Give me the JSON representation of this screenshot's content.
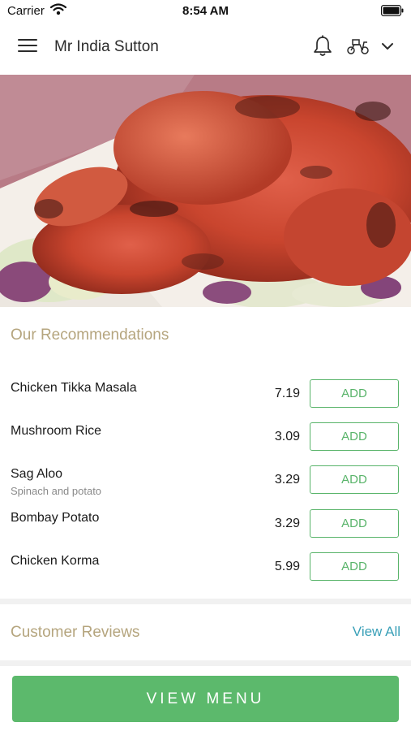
{
  "status_bar": {
    "carrier": "Carrier",
    "time": "8:54 AM"
  },
  "header": {
    "title": "Mr India Sutton",
    "icons": [
      "menu-icon",
      "bell-icon",
      "scooter-icon",
      "chevron-down-icon"
    ]
  },
  "hero": {
    "image": "tandoori-chicken-photo"
  },
  "recommendations": {
    "title": "Our Recommendations",
    "items": [
      {
        "name": "Chicken Tikka Masala",
        "description": "",
        "price": "7.19",
        "button": "ADD"
      },
      {
        "name": "Mushroom Rice",
        "description": "",
        "price": "3.09",
        "button": "ADD"
      },
      {
        "name": "Sag Aloo",
        "description": "Spinach and potato",
        "price": "3.29",
        "button": "ADD"
      },
      {
        "name": "Bombay Potato",
        "description": "",
        "price": "3.29",
        "button": "ADD"
      },
      {
        "name": "Chicken Korma",
        "description": "",
        "price": "5.99",
        "button": "ADD"
      }
    ]
  },
  "reviews": {
    "title": "Customer Reviews",
    "view_all": "View All"
  },
  "footer": {
    "button": "VIEW MENU"
  },
  "colors": {
    "accent_green": "#5cb96c",
    "section_title": "#b5a57e",
    "link": "#3aa0b8"
  }
}
